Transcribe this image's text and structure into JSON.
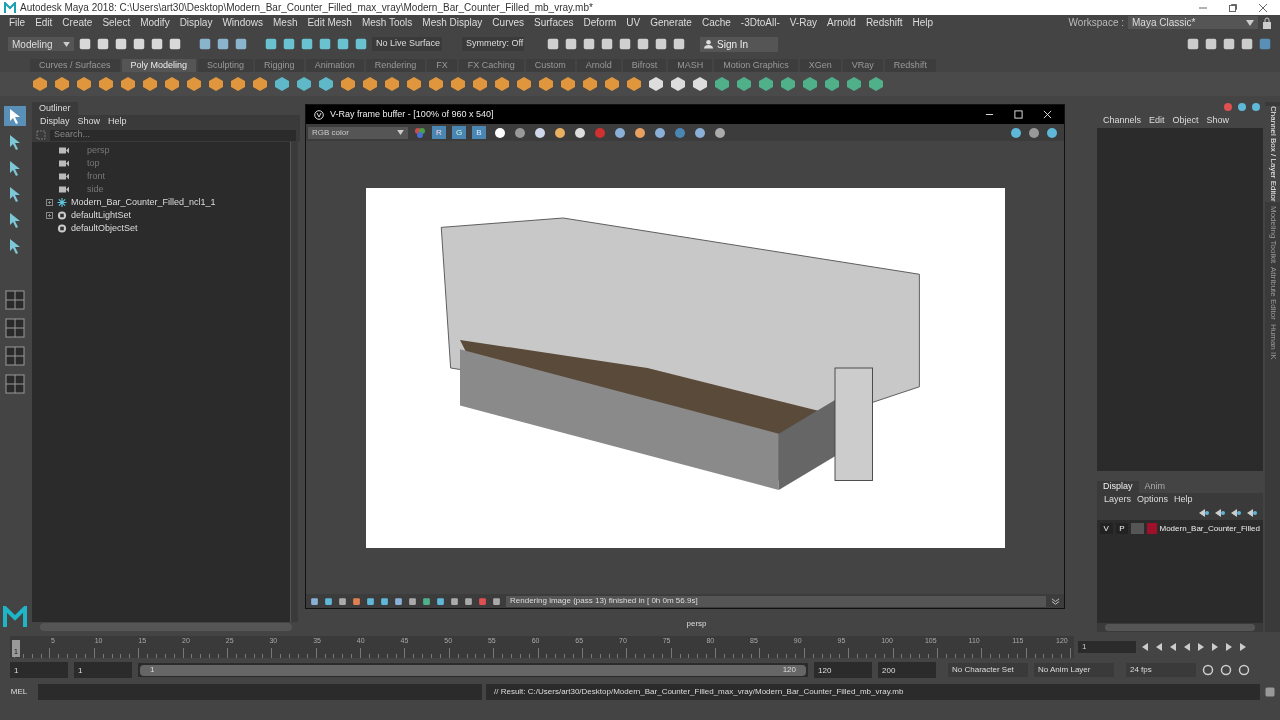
{
  "window": {
    "title": "Autodesk Maya 2018: C:\\Users\\art30\\Desktop\\Modern_Bar_Counter_Filled_max_vray\\Modern_Bar_Counter_Filled_mb_vray.mb*"
  },
  "menu": [
    "File",
    "Edit",
    "Create",
    "Select",
    "Modify",
    "Display",
    "Windows",
    "Mesh",
    "Edit Mesh",
    "Mesh Tools",
    "Mesh Display",
    "Curves",
    "Surfaces",
    "Deform",
    "UV",
    "Generate",
    "Cache",
    "-3DtoAll-",
    "V-Ray",
    "Arnold",
    "Redshift",
    "Help"
  ],
  "workspace": {
    "label": "Workspace :",
    "value": "Maya Classic*"
  },
  "status_line": {
    "mode": "Modeling",
    "live_surface": "No Live Surface",
    "symmetry": "Symmetry: Off",
    "sign_in": "Sign In"
  },
  "shelf_tabs": [
    {
      "label": "Curves / Surfaces",
      "selected": false
    },
    {
      "label": "Poly Modeling",
      "selected": true
    },
    {
      "label": "Sculpting",
      "selected": false
    },
    {
      "label": "Rigging",
      "selected": false
    },
    {
      "label": "Animation",
      "selected": false
    },
    {
      "label": "Rendering",
      "selected": false
    },
    {
      "label": "FX",
      "selected": false
    },
    {
      "label": "FX Caching",
      "selected": false
    },
    {
      "label": "Custom",
      "selected": false
    },
    {
      "label": "Arnold",
      "selected": false
    },
    {
      "label": "Bifrost",
      "selected": false
    },
    {
      "label": "MASH",
      "selected": false
    },
    {
      "label": "Motion Graphics",
      "selected": false
    },
    {
      "label": "XGen",
      "selected": false
    },
    {
      "label": "VRay",
      "selected": false
    },
    {
      "label": "Redshift",
      "selected": false
    }
  ],
  "outliner": {
    "title": "Outliner",
    "menu": [
      "Display",
      "Show",
      "Help"
    ],
    "search": {
      "placeholder": "Search..."
    },
    "items": [
      {
        "kind": "camera",
        "label": "persp",
        "expandable": false
      },
      {
        "kind": "camera",
        "label": "top",
        "expandable": false
      },
      {
        "kind": "camera",
        "label": "front",
        "expandable": false
      },
      {
        "kind": "camera",
        "label": "side",
        "expandable": false
      },
      {
        "kind": "group",
        "label": "Modern_Bar_Counter_Filled_ncl1_1",
        "expandable": true
      },
      {
        "kind": "set",
        "label": "defaultLightSet",
        "expandable": true
      },
      {
        "kind": "set",
        "label": "defaultObjectSet",
        "expandable": false
      }
    ]
  },
  "frame_buffer": {
    "title": "V-Ray frame buffer - [100% of 960 x 540]",
    "channel": "RGB color",
    "channels": [
      {
        "label": "R",
        "selected": true
      },
      {
        "label": "G",
        "selected": true
      },
      {
        "label": "B",
        "selected": true
      }
    ],
    "status": "Rendering image (pass 13) finished in [ 0h  0m 56.9s]"
  },
  "viewport": {
    "camera_label": "persp"
  },
  "channel_box": {
    "menu": [
      "Channels",
      "Edit",
      "Object",
      "Show"
    ],
    "side_tabs": [
      {
        "label": "Channel Box / Layer Editor",
        "selected": true
      },
      {
        "label": "Modeling Toolkit",
        "selected": false
      },
      {
        "label": "Attribute Editor",
        "selected": false
      },
      {
        "label": "Human IK",
        "selected": false
      }
    ]
  },
  "layer_editor": {
    "tabs": [
      {
        "label": "Display",
        "selected": true
      },
      {
        "label": "Anim",
        "selected": false
      }
    ],
    "menu": [
      "Layers",
      "Options",
      "Help"
    ],
    "layers": [
      {
        "visible": "V",
        "playback": "P",
        "name": "Modern_Bar_Counter_Filled",
        "color": "#a0102a"
      }
    ]
  },
  "time_slider": {
    "ticks": [
      "5",
      "10",
      "15",
      "20",
      "25",
      "30",
      "35",
      "40",
      "45",
      "50",
      "55",
      "60",
      "65",
      "70",
      "75",
      "80",
      "85",
      "90",
      "95",
      "100",
      "105",
      "110",
      "115",
      "120"
    ],
    "current_frame": "1",
    "level": 0,
    "frame_field": "1"
  },
  "range": {
    "start": "1",
    "playback_start": "1",
    "slider_start": "1",
    "slider_end": "120",
    "level": 1,
    "playback_end": "120",
    "end": "200",
    "character_set": "No Character Set",
    "anim_layer": "No Anim Layer",
    "fps": "24 fps"
  },
  "command_line": {
    "language": "MEL",
    "result": "// Result: C:/Users/art30/Desktop/Modern_Bar_Counter_Filled_max_vray/Modern_Bar_Counter_Filled_mb_vray.mb"
  }
}
